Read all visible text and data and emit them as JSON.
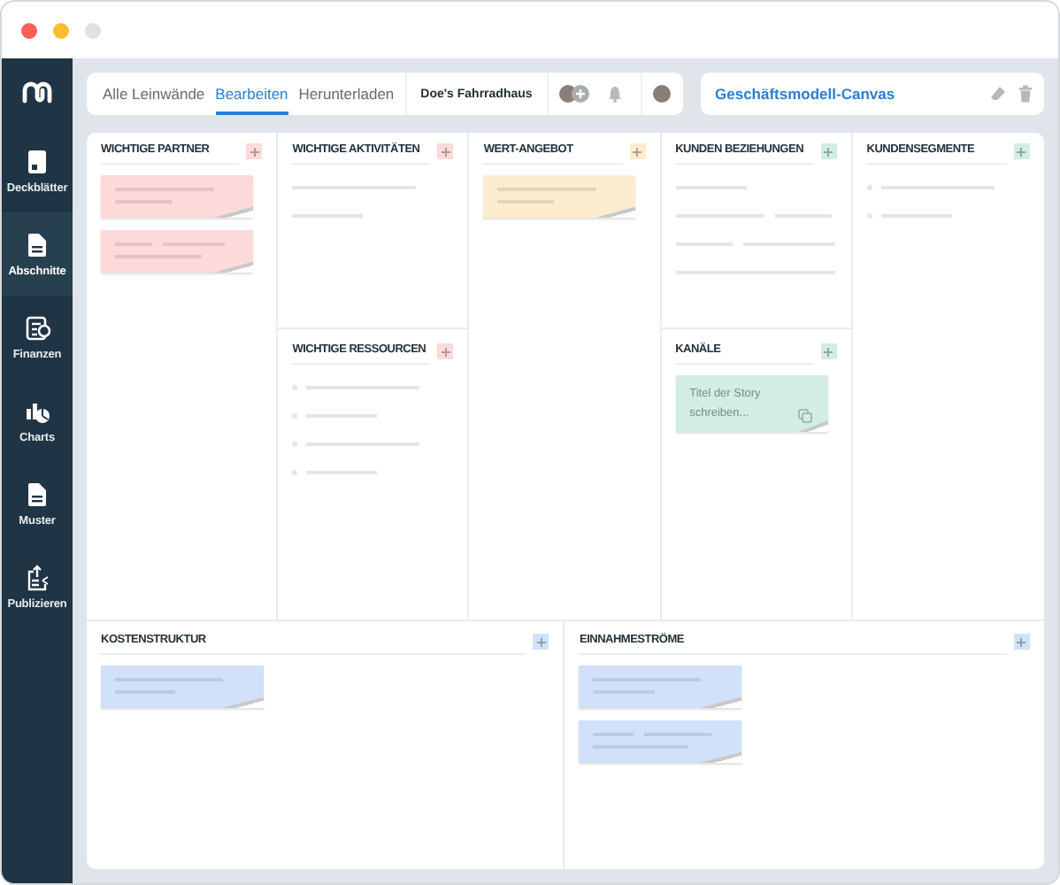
{
  "sidebar": {
    "items": [
      {
        "label": "Deckblätter",
        "selected": false
      },
      {
        "label": "Abschnitte",
        "selected": true
      },
      {
        "label": "Finanzen",
        "selected": false
      },
      {
        "label": "Charts",
        "selected": false
      },
      {
        "label": "Muster",
        "selected": false
      },
      {
        "label": "Publizieren",
        "selected": false
      }
    ]
  },
  "tabs": [
    {
      "label": "Alle Leinwände",
      "selected": false
    },
    {
      "label": "Bearbeiten",
      "selected": true
    },
    {
      "label": "Herunterladen",
      "selected": false
    }
  ],
  "project": "Doe's Fahrradhaus",
  "canvas_title": "Geschäftsmodell-Canvas",
  "blocks": [
    {
      "title": "WICHTIGE PARTNER",
      "color": "#fcdada",
      "kind": "notes",
      "notes": [
        {
          "kind": "sketch"
        },
        {
          "kind": "sketch"
        }
      ]
    },
    {
      "title": "WICHTIGE AKTIVITÄTEN",
      "color": "#fcdada",
      "kind": "lines"
    },
    {
      "title": "WICHTIGE RESSOURCEN",
      "color": "#fcdada",
      "kind": "bullets"
    },
    {
      "title": "WERT-ANGEBOT",
      "color": "#fdecd0",
      "kind": "notes",
      "notes": [
        {
          "kind": "sketch"
        }
      ]
    },
    {
      "title": "KUNDEN BEZIEHUNGEN",
      "color": "#d3ede2",
      "kind": "paragraph"
    },
    {
      "title": "KANÄLE",
      "color": "#d3ede2",
      "kind": "notes",
      "notes": [
        {
          "kind": "text",
          "text": "Titel der Story schreiben..."
        }
      ]
    },
    {
      "title": "KUNDENSEGMENTE",
      "color": "#d3ede2",
      "kind": "pairs"
    },
    {
      "title": "KOSTENSTRUKTUR",
      "color": "#d0e1f9",
      "kind": "notes",
      "notes": [
        {
          "kind": "sketch"
        }
      ]
    },
    {
      "title": "EINNAHMESTRÖME",
      "color": "#d0e1f9",
      "kind": "notes",
      "notes": [
        {
          "kind": "sketch"
        },
        {
          "kind": "sketch"
        }
      ]
    }
  ]
}
